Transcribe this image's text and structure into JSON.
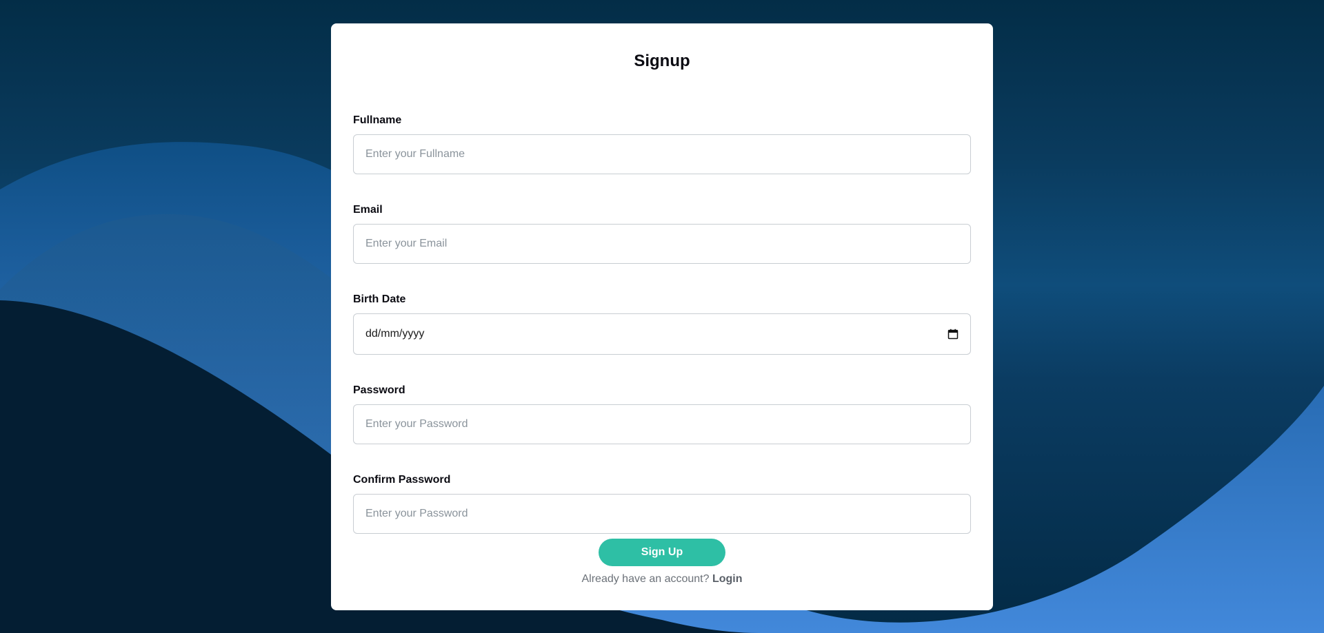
{
  "colors": {
    "background_dark": "#041e33",
    "wave_blue_light": "#3f86d8",
    "wave_blue_mid": "#1a5c98",
    "accent": "#2ebfa5",
    "card": "#ffffff"
  },
  "form": {
    "title": "Signup",
    "fields": {
      "fullname": {
        "label": "Fullname",
        "placeholder": "Enter your Fullname"
      },
      "email": {
        "label": "Email",
        "placeholder": "Enter your Email"
      },
      "birth_date": {
        "label": "Birth Date",
        "value_display": "dd/mm/yyyy",
        "icon": "calendar-icon"
      },
      "password": {
        "label": "Password",
        "placeholder": "Enter your Password"
      },
      "confirm_password": {
        "label": "Confirm Password",
        "placeholder": "Enter your Password"
      }
    },
    "submit_label": "Sign Up",
    "login_prompt": "Already have an account?",
    "login_link": "Login"
  }
}
